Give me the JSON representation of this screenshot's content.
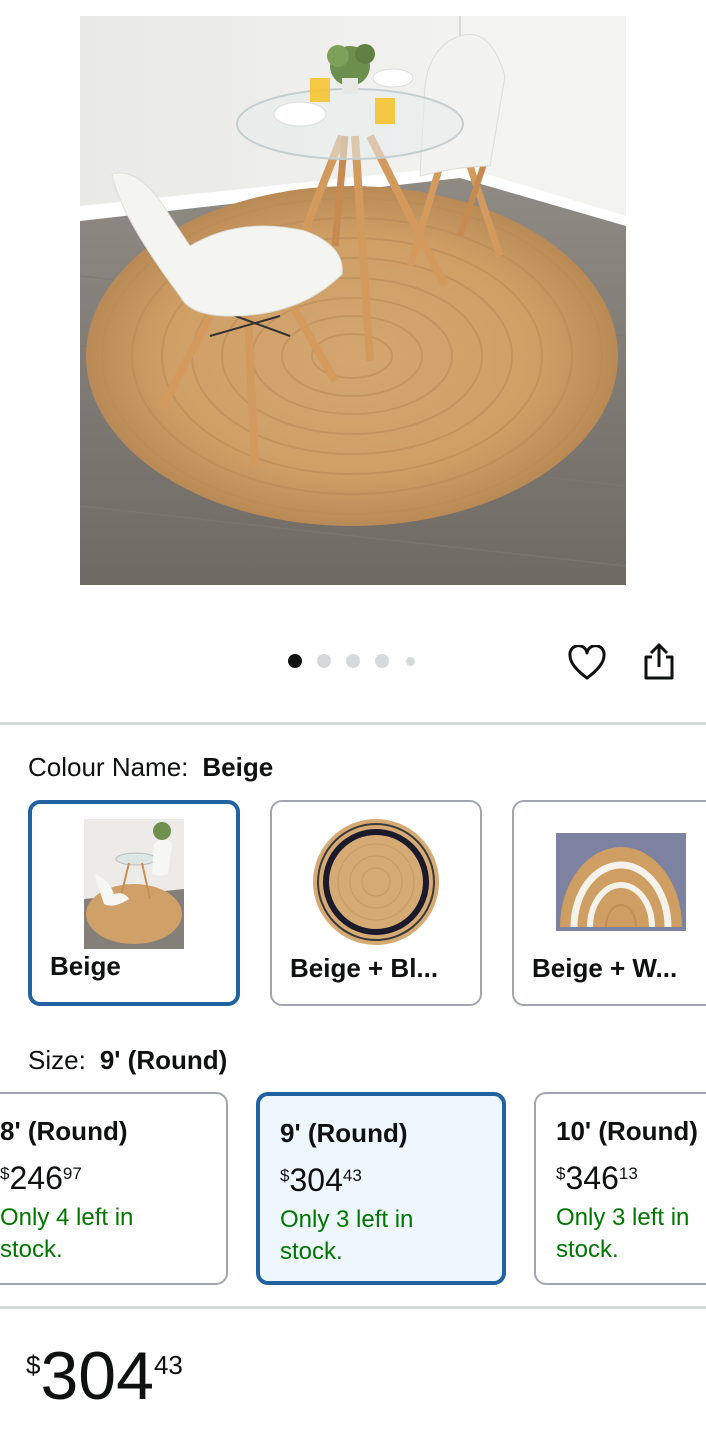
{
  "hero": {
    "image_alt": "Round jute rug with glass table and white chairs"
  },
  "carousel": {
    "total": 5,
    "active_index": 0
  },
  "actions": {
    "favorite_icon": "heart-icon",
    "share_icon": "share-icon"
  },
  "colour": {
    "label": "Colour Name:",
    "selected": "Beige",
    "options": [
      {
        "name": "Beige",
        "thumb": "room-scene"
      },
      {
        "name": "Beige + Bl...",
        "thumb": "round-rug-black-border"
      },
      {
        "name": "Beige + W...",
        "thumb": "half-round-rug-white-border"
      }
    ]
  },
  "size": {
    "label": "Size:",
    "selected": "9' (Round)",
    "options": [
      {
        "name": "8' (Round)",
        "currency": "$",
        "whole": "246",
        "fraction": "97",
        "stock": "Only 4 left in stock."
      },
      {
        "name": "9' (Round)",
        "currency": "$",
        "whole": "304",
        "fraction": "43",
        "stock": "Only 3 left in stock."
      },
      {
        "name": "10' (Round)",
        "currency": "$",
        "whole": "346",
        "fraction": "13",
        "stock": "Only 3 left in stock."
      }
    ]
  },
  "price": {
    "currency": "$",
    "whole": "304",
    "fraction": "43"
  },
  "colors": {
    "selected_border": "#2162a1",
    "selected_bg": "#edf7fd",
    "stock_green": "#007600",
    "border_grey": "#a2a6ac",
    "dot_inactive": "#d5d9d9",
    "dot_active": "#0f1111"
  }
}
